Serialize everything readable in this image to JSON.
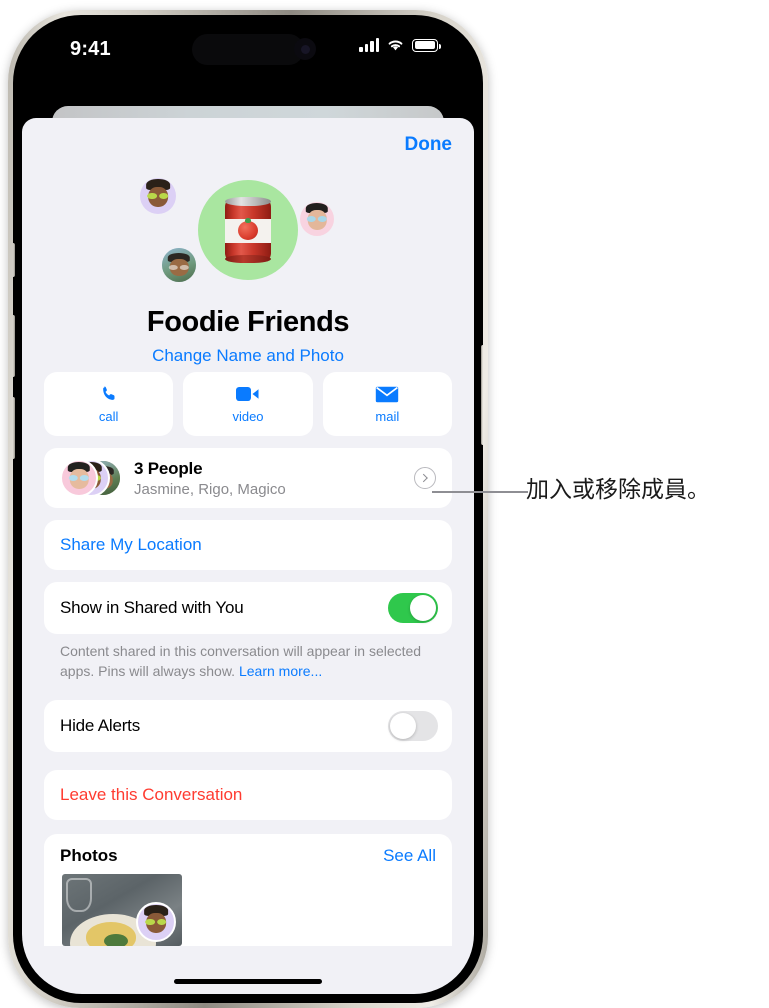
{
  "status_bar": {
    "time": "9:41",
    "icons": [
      "cellular-signal-icon",
      "wifi-icon",
      "battery-icon"
    ]
  },
  "sheet": {
    "done_label": "Done"
  },
  "group": {
    "name": "Foodie Friends",
    "change_link": "Change Name and Photo",
    "avatar_emoji": "canned-food-icon",
    "member_avatars": [
      "memoji-purple",
      "memoji-pink",
      "photo-avatar"
    ]
  },
  "actions": [
    {
      "label": "call",
      "icon": "phone-icon"
    },
    {
      "label": "video",
      "icon": "video-camera-icon"
    },
    {
      "label": "mail",
      "icon": "envelope-icon"
    }
  ],
  "people": {
    "title": "3 People",
    "members": "Jasmine, Rigo, Magico",
    "chevron": "chevron-right-icon"
  },
  "share_location": {
    "label": "Share My Location"
  },
  "shared_with_you": {
    "label": "Show in Shared with You",
    "enabled": true,
    "footnote": "Content shared in this conversation will appear in selected apps. Pins will always show.",
    "learn_more": "Learn more..."
  },
  "hide_alerts": {
    "label": "Hide Alerts",
    "enabled": false
  },
  "leave": {
    "label": "Leave this Conversation"
  },
  "photos": {
    "title": "Photos",
    "see_all": "See All"
  },
  "annotation": {
    "text": "加入或移除成員。"
  },
  "colors": {
    "accent_blue": "#0a7bff",
    "danger_red": "#FF3B30",
    "toggle_green": "#2FC84C",
    "sheet_bg": "#F1F1F6",
    "avatar_green": "#A9E6A0"
  }
}
